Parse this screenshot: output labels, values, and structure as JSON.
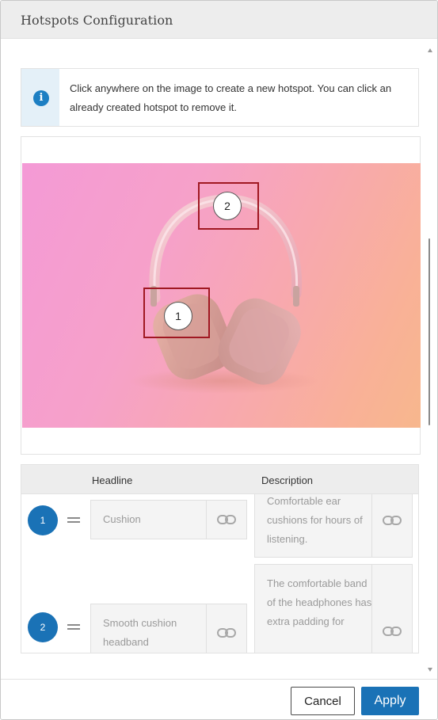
{
  "dialog": {
    "title": "Hotspots Configuration"
  },
  "info": {
    "icon": "info-icon",
    "text": "Click anywhere on the image to create a new hotspot. You can click an already created hotspot to remove it."
  },
  "image": {
    "subject": "headphones",
    "hotspots": [
      {
        "number": "1"
      },
      {
        "number": "2"
      }
    ]
  },
  "table": {
    "headers": {
      "headline": "Headline",
      "description": "Description"
    },
    "rows": [
      {
        "number": "1",
        "headline": "Cushion",
        "description": "Comfortable ear cushions for hours of listening."
      },
      {
        "number": "2",
        "headline": "Smooth cushion headband",
        "description": "The comfortable band of the headphones has extra padding for"
      }
    ]
  },
  "footer": {
    "cancel_label": "Cancel",
    "apply_label": "Apply"
  },
  "colors": {
    "accent": "#1a72b6",
    "hotspot_outline": "#a01822",
    "header_bg": "#ededed",
    "info_bg": "#e4f0f8"
  }
}
